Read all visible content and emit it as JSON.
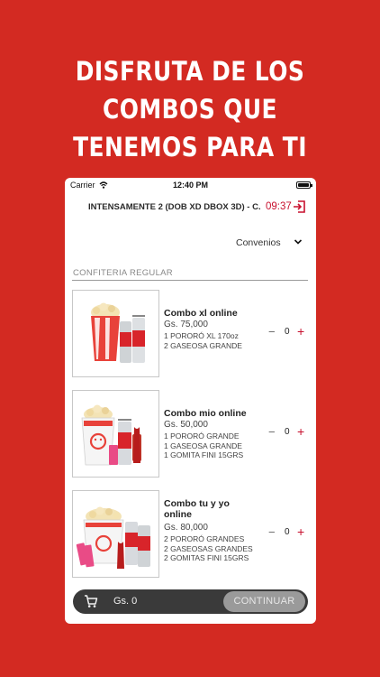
{
  "headline": {
    "line1": "DISFRUTA DE LOS",
    "line2": "COMBOS QUE",
    "line3": "TENEMOS PARA TI"
  },
  "status_bar": {
    "carrier": "Carrier",
    "time": "12:40 PM",
    "wifi_icon": "wifi-icon",
    "battery_icon": "battery-icon"
  },
  "header": {
    "movie_title": "INTENSAMENTE 2 (DOB XD DBOX 3D) - C...",
    "timer": "09:37",
    "exit_icon": "exit-icon"
  },
  "filter": {
    "label": "Convenios",
    "icon": "chevron-down-icon"
  },
  "section": {
    "title": "CONFITERIA REGULAR"
  },
  "combos": [
    {
      "name": "Combo xl online",
      "price": "Gs. 75,000",
      "items": [
        "1 PORORÓ XL 170oz",
        "2 GASEOSA GRANDE"
      ],
      "quantity": "0"
    },
    {
      "name": "Combo mio online",
      "price": "Gs. 50,000",
      "items": [
        "1 PORORÓ GRANDE",
        "1 GASEOSA GRANDE",
        "1 GOMITA FINI 15GRS"
      ],
      "quantity": "0"
    },
    {
      "name": "Combo tu y yo online",
      "price": "Gs. 80,000",
      "items": [
        "2 PORORÓ GRANDES",
        "2 GASEOSAS GRANDES",
        "2 GOMITAS FINI 15GRS"
      ],
      "quantity": "0"
    }
  ],
  "stepper": {
    "minus": "−",
    "plus": "+"
  },
  "cart": {
    "icon": "cart-icon",
    "total": "Gs. 0",
    "continue_label": "CONTINUAR"
  },
  "colors": {
    "background": "#d32a22",
    "accent": "#c8102e",
    "cart_bar": "#3a3a3a",
    "continue_button": "#9a9a9a"
  }
}
